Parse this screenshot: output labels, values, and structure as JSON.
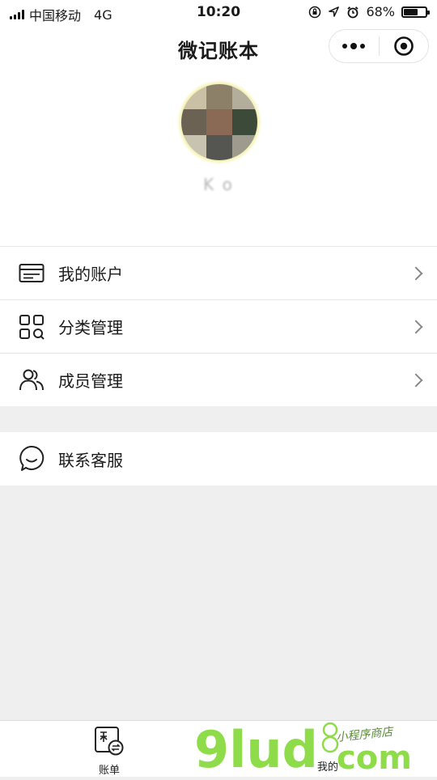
{
  "status": {
    "carrier": "中国移动",
    "network": "4G",
    "time": "10:20",
    "battery_percent": "68%",
    "battery_level": 0.68
  },
  "nav": {
    "title": "微记账本"
  },
  "profile": {
    "username": "K o"
  },
  "menu_group1": [
    {
      "label": "我的账户",
      "icon": "card-icon"
    },
    {
      "label": "分类管理",
      "icon": "category-grid-icon"
    },
    {
      "label": "成员管理",
      "icon": "members-icon"
    }
  ],
  "menu_group2": [
    {
      "label": "联系客服",
      "icon": "chat-bubble-icon"
    }
  ],
  "tabbar": {
    "bill_label": "账单",
    "mine_label": "我的"
  },
  "watermark": {
    "brand": "9lud",
    "suffix": "com",
    "tagline": "小程序商店"
  },
  "colors": {
    "accent_green": "#8fdc4a",
    "background": "#efefef"
  }
}
